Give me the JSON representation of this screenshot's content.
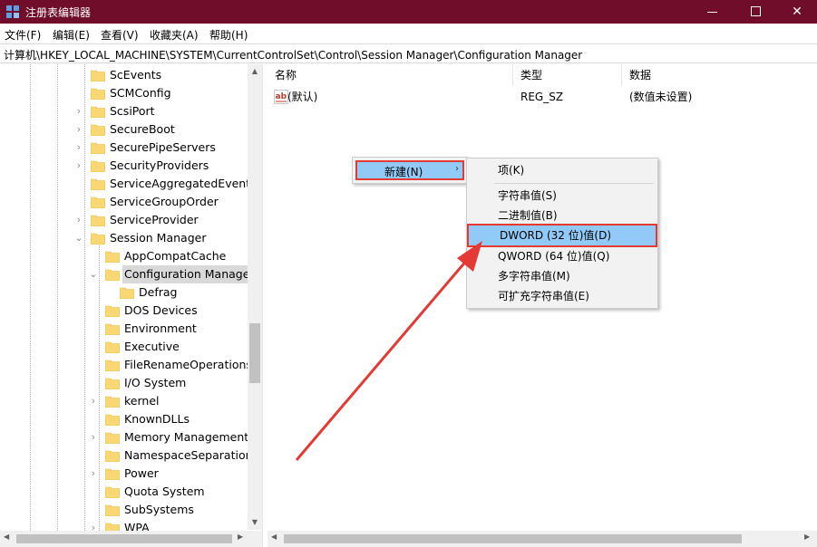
{
  "window": {
    "title": "注册表编辑器",
    "accent": "#6f0d2b",
    "buttons": {
      "minimize": "minimize",
      "maximize": "maximize",
      "close": "✕"
    }
  },
  "menu": [
    "文件(F)",
    "编辑(E)",
    "查看(V)",
    "收藏夹(A)",
    "帮助(H)"
  ],
  "address": "计算机\\HKEY_LOCAL_MACHINE\\SYSTEM\\CurrentControlSet\\Control\\Session Manager\\Configuration Manager",
  "tree": [
    {
      "label": "ScEvents",
      "expander": "",
      "level": 0
    },
    {
      "label": "SCMConfig",
      "expander": "",
      "level": 0
    },
    {
      "label": "ScsiPort",
      "expander": "›",
      "level": 0
    },
    {
      "label": "SecureBoot",
      "expander": "›",
      "level": 0
    },
    {
      "label": "SecurePipeServers",
      "expander": "›",
      "level": 0
    },
    {
      "label": "SecurityProviders",
      "expander": "›",
      "level": 0
    },
    {
      "label": "ServiceAggregatedEvents",
      "expander": "",
      "level": 0
    },
    {
      "label": "ServiceGroupOrder",
      "expander": "",
      "level": 0
    },
    {
      "label": "ServiceProvider",
      "expander": "›",
      "level": 0
    },
    {
      "label": "Session Manager",
      "expander": "⌄",
      "level": 0
    },
    {
      "label": "AppCompatCache",
      "expander": "",
      "level": 1
    },
    {
      "label": "Configuration Manager",
      "expander": "⌄",
      "level": 1,
      "selected": true
    },
    {
      "label": "Defrag",
      "expander": "",
      "level": 2
    },
    {
      "label": "DOS Devices",
      "expander": "",
      "level": 1
    },
    {
      "label": "Environment",
      "expander": "",
      "level": 1
    },
    {
      "label": "Executive",
      "expander": "",
      "level": 1
    },
    {
      "label": "FileRenameOperations",
      "expander": "",
      "level": 1
    },
    {
      "label": "I/O System",
      "expander": "",
      "level": 1
    },
    {
      "label": "kernel",
      "expander": "›",
      "level": 1
    },
    {
      "label": "KnownDLLs",
      "expander": "",
      "level": 1
    },
    {
      "label": "Memory Management",
      "expander": "›",
      "level": 1
    },
    {
      "label": "NamespaceSeparation",
      "expander": "",
      "level": 1
    },
    {
      "label": "Power",
      "expander": "›",
      "level": 1
    },
    {
      "label": "Quota System",
      "expander": "",
      "level": 1
    },
    {
      "label": "SubSystems",
      "expander": "",
      "level": 1
    },
    {
      "label": "WPA",
      "expander": "›",
      "level": 1
    }
  ],
  "columns": {
    "name": "名称",
    "type": "类型",
    "data": "数据"
  },
  "values": [
    {
      "name": "(默认)",
      "type": "REG_SZ",
      "data": "(数值未设置)",
      "icon": "ab-string-icon"
    }
  ],
  "context_menu": {
    "new_label": "新建(N)",
    "submenu_arrow": "›",
    "submenu": [
      {
        "label": "项(K)"
      },
      {
        "label": "字符串值(S)"
      },
      {
        "label": "二进制值(B)"
      },
      {
        "label": "DWORD (32 位)值(D)",
        "highlighted": true
      },
      {
        "label": "QWORD (64 位)值(Q)"
      },
      {
        "label": "多字符串值(M)"
      },
      {
        "label": "可扩充字符串值(E)"
      }
    ]
  },
  "colors": {
    "highlight": "#91c9f7",
    "annotation_red": "#e53935",
    "folder": "#f8d775"
  }
}
